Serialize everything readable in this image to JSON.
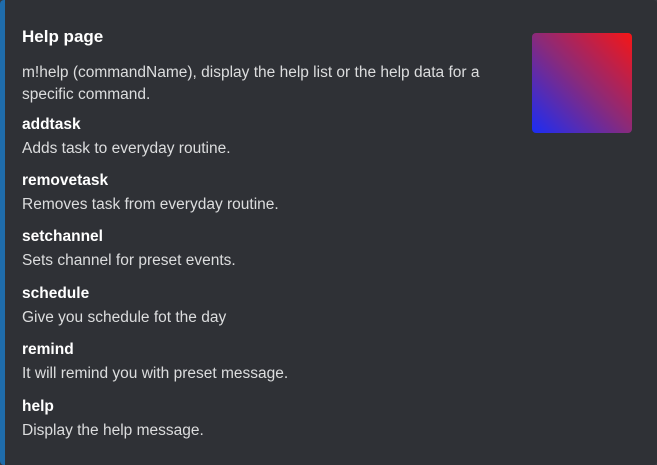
{
  "embed": {
    "title": "Help page",
    "description": "m!help (commandName), display the help list or the help data for a specific command.",
    "accent_color": "#1f6cab",
    "thumbnail": "gradient-thumbnail"
  },
  "fields": [
    {
      "name": "addtask",
      "value": "Adds task to everyday routine."
    },
    {
      "name": "removetask",
      "value": "Removes task from everyday routine."
    },
    {
      "name": "setchannel",
      "value": "Sets channel for preset events."
    },
    {
      "name": "schedule",
      "value": "Give you schedule fot the day"
    },
    {
      "name": "remind",
      "value": "It will remind you with preset message."
    },
    {
      "name": "help",
      "value": "Display the help message."
    }
  ]
}
